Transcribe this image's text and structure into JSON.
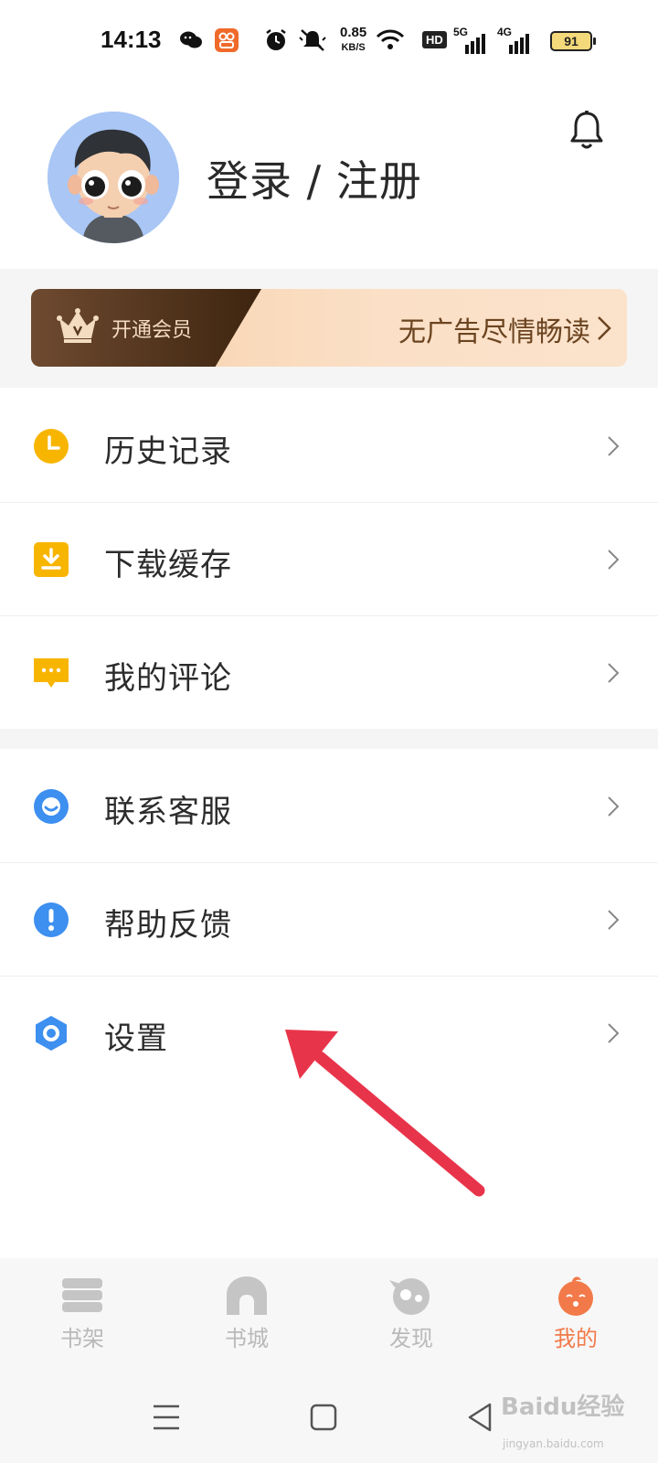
{
  "status_bar": {
    "time": "14:13",
    "net_speed_value": "0.85",
    "net_speed_unit": "KB/S",
    "hd_label": "HD",
    "net1": "5G",
    "net2": "4G",
    "battery": "91",
    "icons": [
      "wechat-icon",
      "app-notification-icon",
      "alarm-icon",
      "mute-icon",
      "wifi-icon",
      "signal-icon",
      "battery-icon"
    ]
  },
  "header": {
    "login_title": "登录 / 注册",
    "bell_icon": "bell-icon"
  },
  "vip": {
    "left_label": "开通会员",
    "right_label": "无广告尽情畅读",
    "accent_dark": "#3e250f",
    "accent_light": "#fbe0c7"
  },
  "menu_group_1": [
    {
      "label": "历史记录",
      "icon": "clock-icon",
      "color": "#f7b500"
    },
    {
      "label": "下载缓存",
      "icon": "download-icon",
      "color": "#f7b500"
    },
    {
      "label": "我的评论",
      "icon": "comment-icon",
      "color": "#f7b500"
    }
  ],
  "menu_group_2": [
    {
      "label": "联系客服",
      "icon": "customer-service-icon",
      "color": "#3d8ff0"
    },
    {
      "label": "帮助反馈",
      "icon": "help-feedback-icon",
      "color": "#3d8ff0"
    },
    {
      "label": "设置",
      "icon": "settings-icon",
      "color": "#3d8ff0"
    }
  ],
  "tabs": [
    {
      "label": "书架",
      "icon": "bookshelf-icon",
      "active": false
    },
    {
      "label": "书城",
      "icon": "bookstore-icon",
      "active": false
    },
    {
      "label": "发现",
      "icon": "discover-icon",
      "active": false
    },
    {
      "label": "我的",
      "icon": "mine-icon",
      "active": true
    }
  ],
  "tab_active_color": "#f27a4a",
  "annotation_color": "#e8344a",
  "watermark": {
    "main": "Baidu经验",
    "sub": "jingyan.baidu.com"
  }
}
